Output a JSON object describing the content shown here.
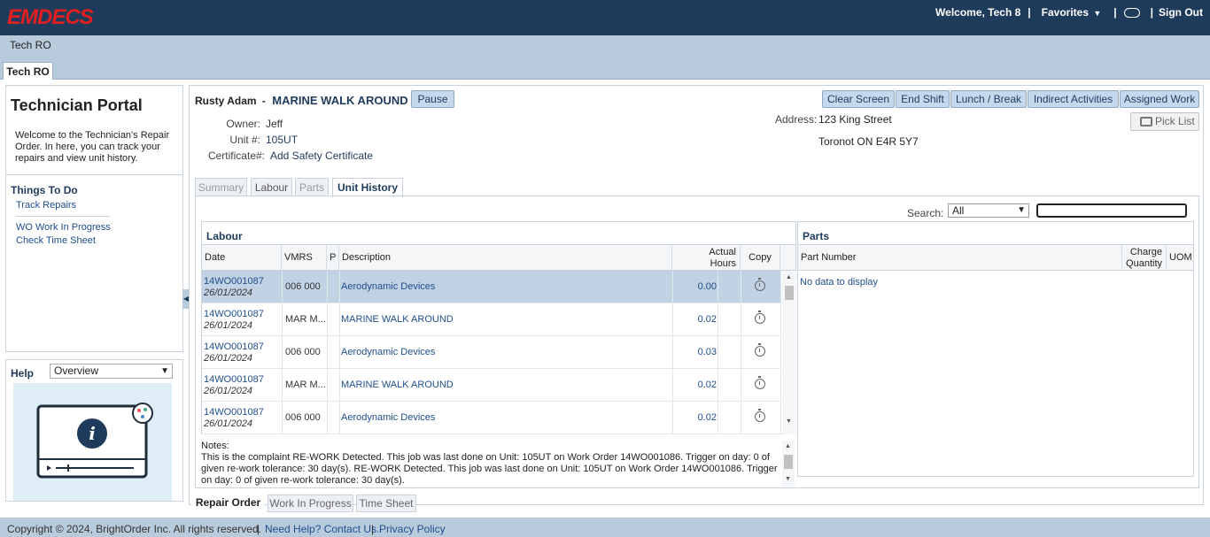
{
  "app": {
    "logo": "EMDECS",
    "welcome": "Welcome, Tech 8",
    "favorites": "Favorites",
    "sign_out": "Sign Out",
    "separator": "|",
    "breadcrumb": "Tech RO",
    "tab": "Tech RO"
  },
  "sidebar": {
    "title": "Technician Portal",
    "description": "Welcome to the Technician's Repair Order. In here, you can track your repairs and view unit history.",
    "todo_title": "Things To Do",
    "links": [
      "Track Repairs",
      "WO Work In Progress",
      "Check Time Sheet"
    ],
    "help_label": "Help",
    "help_option": "Overview"
  },
  "work_order": {
    "tech_name": "Rusty Adam",
    "dash": "-",
    "job": "MARINE WALK AROUND",
    "pause": "Pause",
    "owner_label": "Owner:",
    "owner": "Jeff",
    "unit_label": "Unit #:",
    "unit": "105UT",
    "cert_label": "Certificate#:",
    "cert_link": "Add Safety Certificate",
    "address_label": "Address:",
    "address_line1": "123 King Street",
    "address_line2": "Toronot ON E4R 5Y7"
  },
  "actions": {
    "clear": "Clear Screen",
    "end_shift": "End Shift",
    "lunch": "Lunch / Break",
    "indirect": "Indirect Activities",
    "assigned": "Assigned Work",
    "pick_list": "Pick List"
  },
  "tabs": [
    "Summary",
    "Labour",
    "Parts",
    "Unit History"
  ],
  "search": {
    "label": "Search:",
    "filter": "All",
    "value": ""
  },
  "labour": {
    "title": "Labour",
    "columns": {
      "date": "Date",
      "vmrs": "VMRS",
      "p": "P",
      "description": "Description",
      "hours_line1": "Actual",
      "hours_line2": "Hours",
      "copy": "Copy"
    },
    "rows": [
      {
        "wo": "14WO001087",
        "date": "26/01/2024",
        "vmrs": "006 000",
        "description": "Aerodynamic Devices",
        "hours": "0.00"
      },
      {
        "wo": "14WO001087",
        "date": "26/01/2024",
        "vmrs": "MAR M...",
        "description": "MARINE WALK AROUND",
        "hours": "0.02"
      },
      {
        "wo": "14WO001087",
        "date": "26/01/2024",
        "vmrs": "006 000",
        "description": "Aerodynamic Devices",
        "hours": "0.03"
      },
      {
        "wo": "14WO001087",
        "date": "26/01/2024",
        "vmrs": "MAR M...",
        "description": "MARINE WALK AROUND",
        "hours": "0.02"
      },
      {
        "wo": "14WO001087",
        "date": "26/01/2024",
        "vmrs": "006 000",
        "description": "Aerodynamic Devices",
        "hours": "0.02"
      }
    ],
    "notes_label": "Notes:",
    "notes": "This is the complaint RE-WORK Detected. This job was last done on Unit: 105UT on Work Order 14WO001086. Trigger on day: 0 of given re-work tolerance: 30 day(s). RE-WORK Detected. This job was last done on Unit: 105UT on Work Order 14WO001086. Trigger on day: 0 of given re-work tolerance: 30 day(s)."
  },
  "parts": {
    "title": "Parts",
    "columns": {
      "part_number": "Part Number",
      "charge_line1": "Charge",
      "charge_line2": "Quantity",
      "uom": "UOM"
    },
    "empty": "No data to display"
  },
  "bottom_tabs": [
    "Repair Order",
    "Work In Progress",
    "Time Sheet"
  ],
  "footer": {
    "copyright": "Copyright © 2024, BrightOrder Inc. All rights reserved.",
    "help": "Need Help? Contact Us.",
    "privacy": "Privacy Policy",
    "separator": "|"
  },
  "colors": {
    "topbar": "#1f3b5c",
    "logo": "#e21f1f",
    "page_bg": "#b8cbdc",
    "selected_row": "#c1d2e5",
    "button": "#c6d9ec"
  }
}
